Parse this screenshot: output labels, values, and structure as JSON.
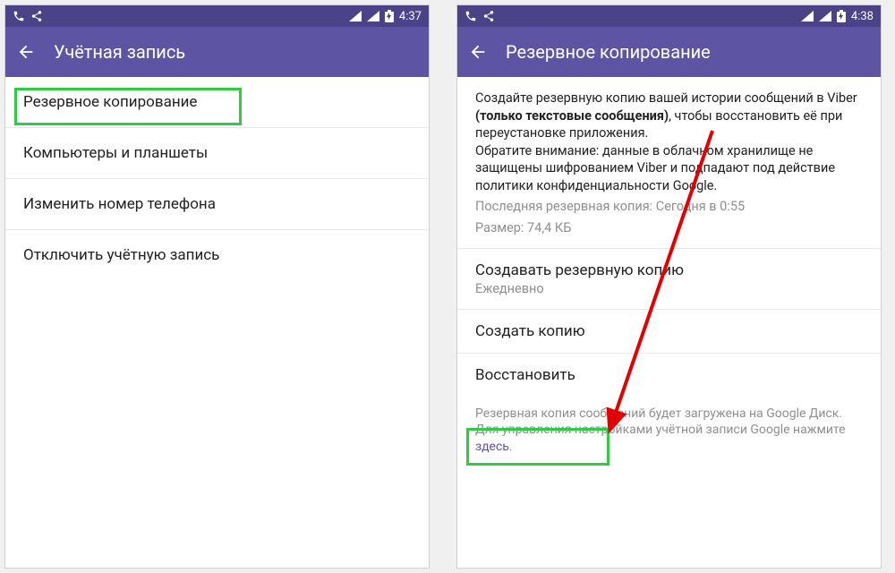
{
  "left": {
    "status_time": "4:37",
    "header_title": "Учётная запись",
    "items": [
      "Резервное копирование",
      "Компьютеры и планшеты",
      "Изменить номер телефона",
      "Отключить учётную запись"
    ]
  },
  "right": {
    "status_time": "4:38",
    "header_title": "Резервное копирование",
    "info_prefix": "Создайте резервную копию вашей истории сообщений в Viber ",
    "info_bold": "(только текстовые сообщения)",
    "info_suffix": ", чтобы восстановить её при переустановке приложения.",
    "info_note": "Обратите внимание: данные в облачном хранилище не защищены шифрованием Viber и подпадают под действие политики конфиденциальности Google.",
    "last_copy": "Последняя резервная копия: Сегодня в 0:55",
    "size": "Размер: 74,4 КБ",
    "create_backup_label": "Создавать резервную копию",
    "create_backup_value": "Ежедневно",
    "create_copy_label": "Создать копию",
    "restore_label": "Восстановить",
    "footer_prefix": "Резервная копия сообщений будет загружена на Google Диск. Для управления настройками учётной записи Google нажмите ",
    "footer_link": "здесь",
    "footer_suffix": "."
  }
}
